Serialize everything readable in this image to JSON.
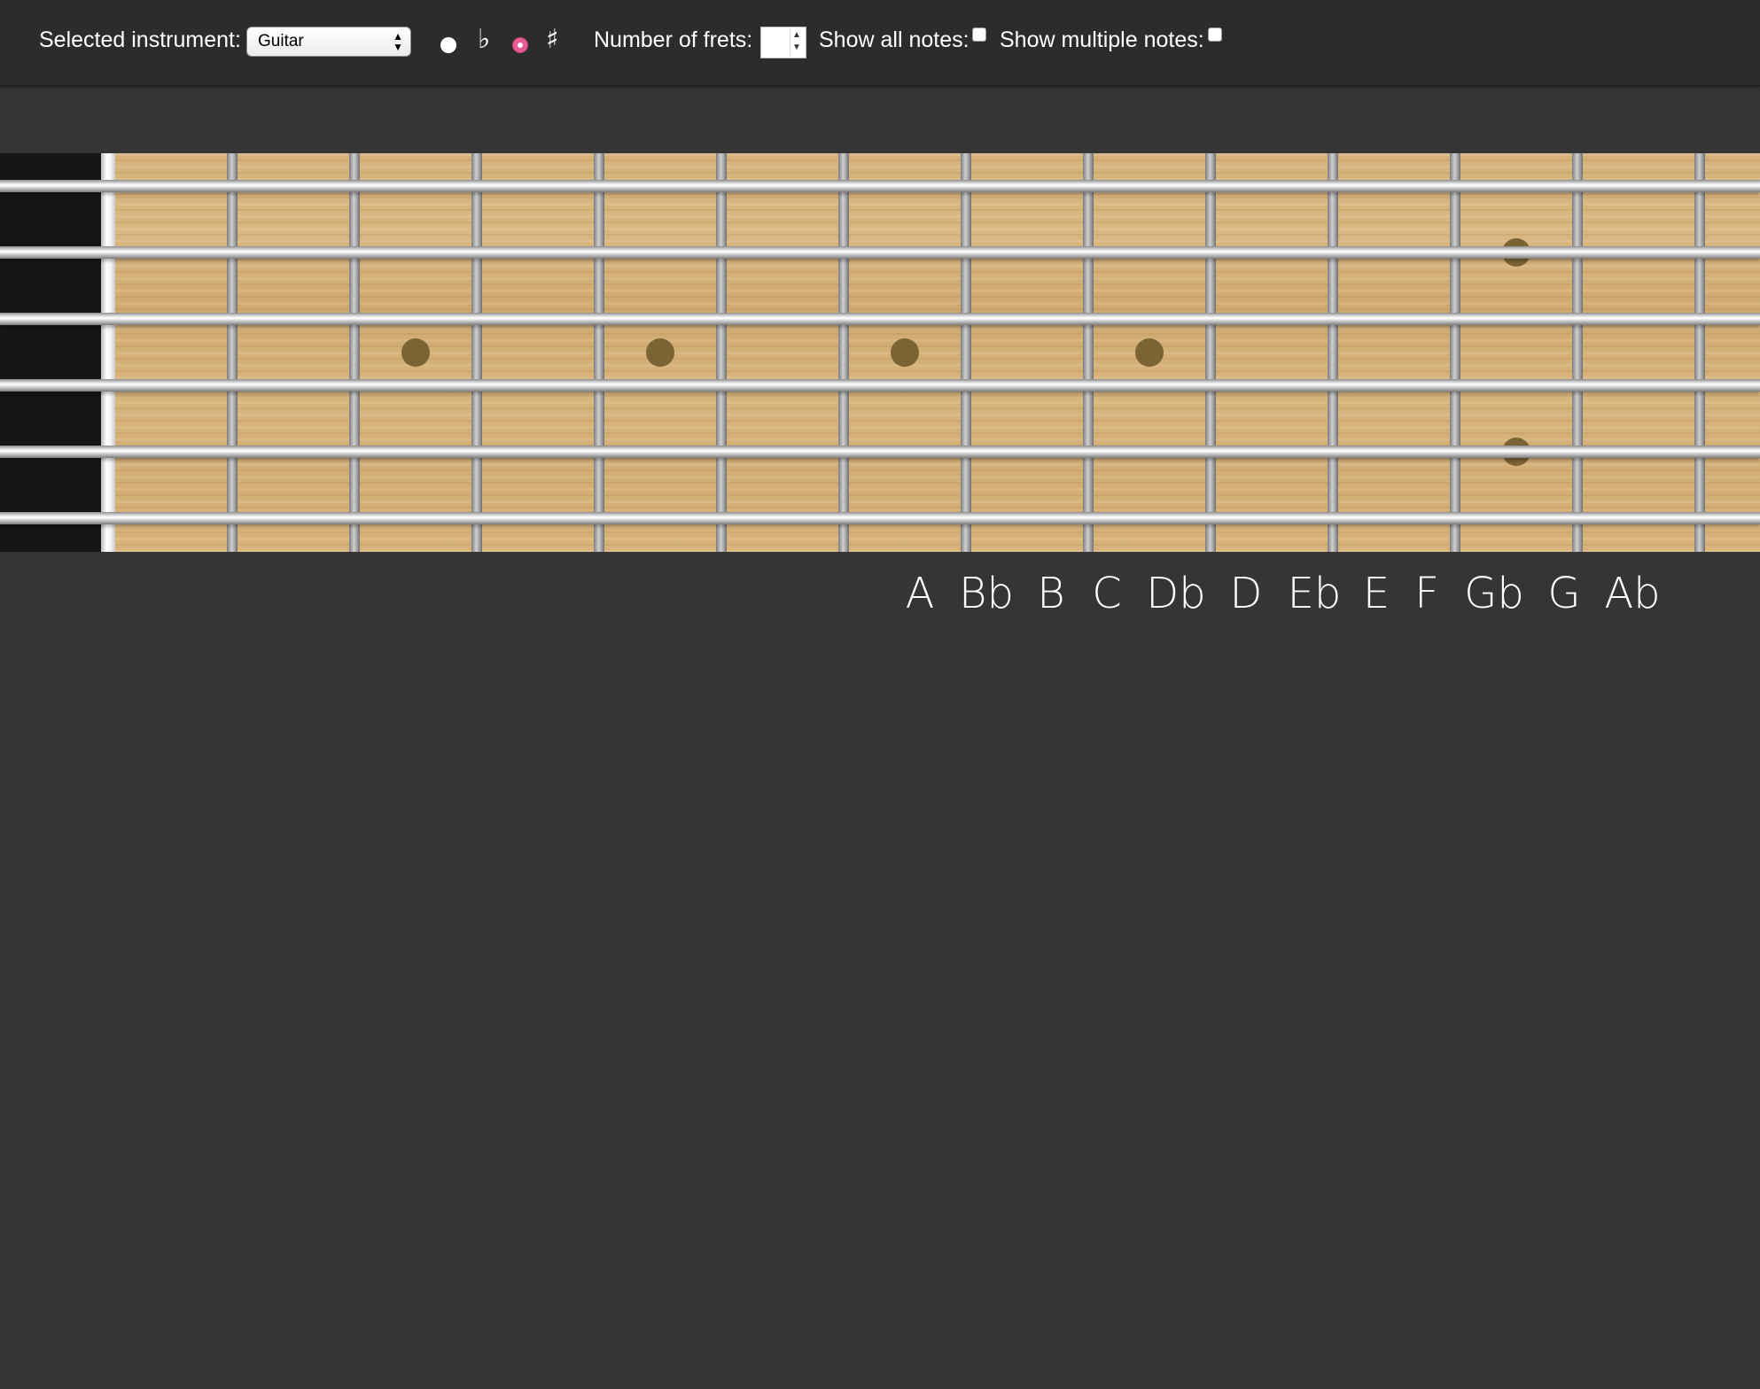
{
  "toolbar": {
    "instrument_label": "Selected instrument:",
    "instrument_value": "Guitar",
    "natural_symbol": "●",
    "flat_symbol": "♭",
    "sharp_symbol": "♯",
    "selected_accidental": "sharp",
    "frets_label": "Number of frets:",
    "frets_value": "",
    "show_all_label": "Show all notes:",
    "show_all_checked": false,
    "show_multiple_label": "Show multiple notes:",
    "show_multiple_checked": false
  },
  "fretboard": {
    "strings": 6,
    "visible_frets": 14,
    "inlays": [
      {
        "fret": 3,
        "type": "single"
      },
      {
        "fret": 5,
        "type": "single"
      },
      {
        "fret": 7,
        "type": "single"
      },
      {
        "fret": 9,
        "type": "single"
      },
      {
        "fret": 12,
        "type": "double"
      }
    ],
    "wood_color": "#d6b27a",
    "inlay_color": "#7a6434"
  },
  "notes": [
    "A",
    "Bb",
    "B",
    "C",
    "Db",
    "D",
    "Eb",
    "E",
    "F",
    "Gb",
    "G",
    "Ab"
  ],
  "colors": {
    "background": "#353535",
    "toolbar": "#2c2c2c",
    "accent": "#e85a93"
  }
}
